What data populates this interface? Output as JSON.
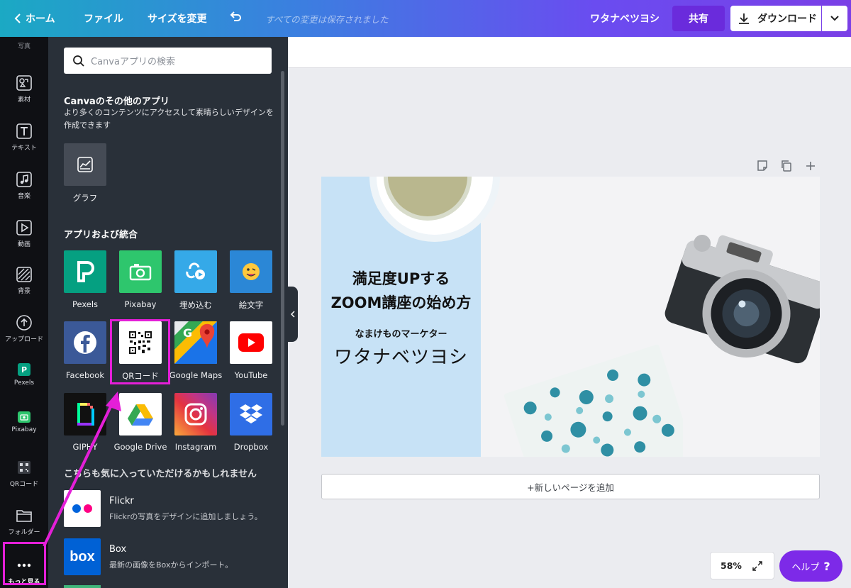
{
  "topbar": {
    "home": "ホーム",
    "file": "ファイル",
    "resize": "サイズを変更",
    "saved_status": "すべての変更は保存されました",
    "user": "ワタナベツヨシ",
    "share": "共有",
    "download": "ダウンロード"
  },
  "rail": {
    "photos": "写真",
    "elements": "素材",
    "text": "テキスト",
    "audio": "音楽",
    "video": "動画",
    "background": "背景",
    "upload": "アップロード",
    "pexels": "Pexels",
    "pixabay": "Pixabay",
    "qr": "QRコード",
    "folder": "フォルダー",
    "more": "もっと見る"
  },
  "panel": {
    "search_placeholder": "Canvaアプリの検索",
    "other_apps_title": "Canvaのその他のアプリ",
    "other_apps_desc": "より多くのコンテンツにアクセスして素晴らしいデザインを作成できます",
    "graph_label": "グラフ",
    "integrations_title": "アプリおよび統合",
    "apps": [
      "Pexels",
      "Pixabay",
      "埋め込む",
      "絵文字",
      "Facebook",
      "QRコード",
      "Google Maps",
      "YouTube",
      "GIPHY",
      "Google Drive",
      "Instagram",
      "Dropbox"
    ],
    "recommend_title": "こちらも気に入っていただけるかもしれません",
    "recommend": [
      {
        "name": "Flickr",
        "desc": "Flickrの写真をデザインに追加しましょう。"
      },
      {
        "name": "Box",
        "desc": "最新の画像をBoxからインポート。"
      }
    ]
  },
  "canvas": {
    "title_line1": "満足度UPする",
    "title_line2": "ZOOM講座の始め方",
    "subtitle": "なまけものマーケター",
    "author": "ワタナベツヨシ",
    "add_page": "+新しいページを追加",
    "zoom": "58%",
    "help": "ヘルプ",
    "help_mark": "?"
  },
  "colors": {
    "accent": "#7d2ae8",
    "highlight": "#e41fd8",
    "panel_bg": "#293039",
    "rail_bg": "#0f1014"
  }
}
